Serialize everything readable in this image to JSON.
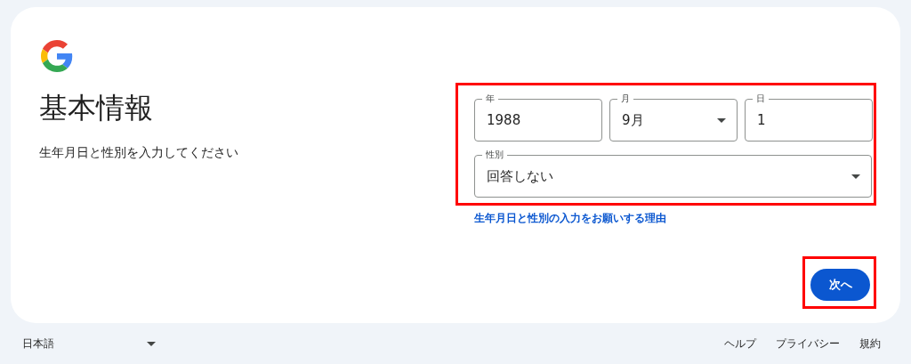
{
  "title": "基本情報",
  "subtitle": "生年月日と性別を入力してください",
  "form": {
    "highlighted": true,
    "date_fields": [
      {
        "kind": "text",
        "label": "年",
        "value": "1988"
      },
      {
        "kind": "select",
        "label": "月",
        "value": "9月"
      },
      {
        "kind": "text",
        "label": "日",
        "value": "1"
      }
    ],
    "gender_field": {
      "kind": "select",
      "label": "性別",
      "value": "回答しない"
    }
  },
  "reason_link": "生年月日と性別の入力をお願いする理由",
  "next_button": {
    "label": "次へ",
    "highlighted": true
  },
  "footer": {
    "language": "日本語",
    "links": [
      "ヘルプ",
      "プライバシー",
      "規約"
    ]
  }
}
